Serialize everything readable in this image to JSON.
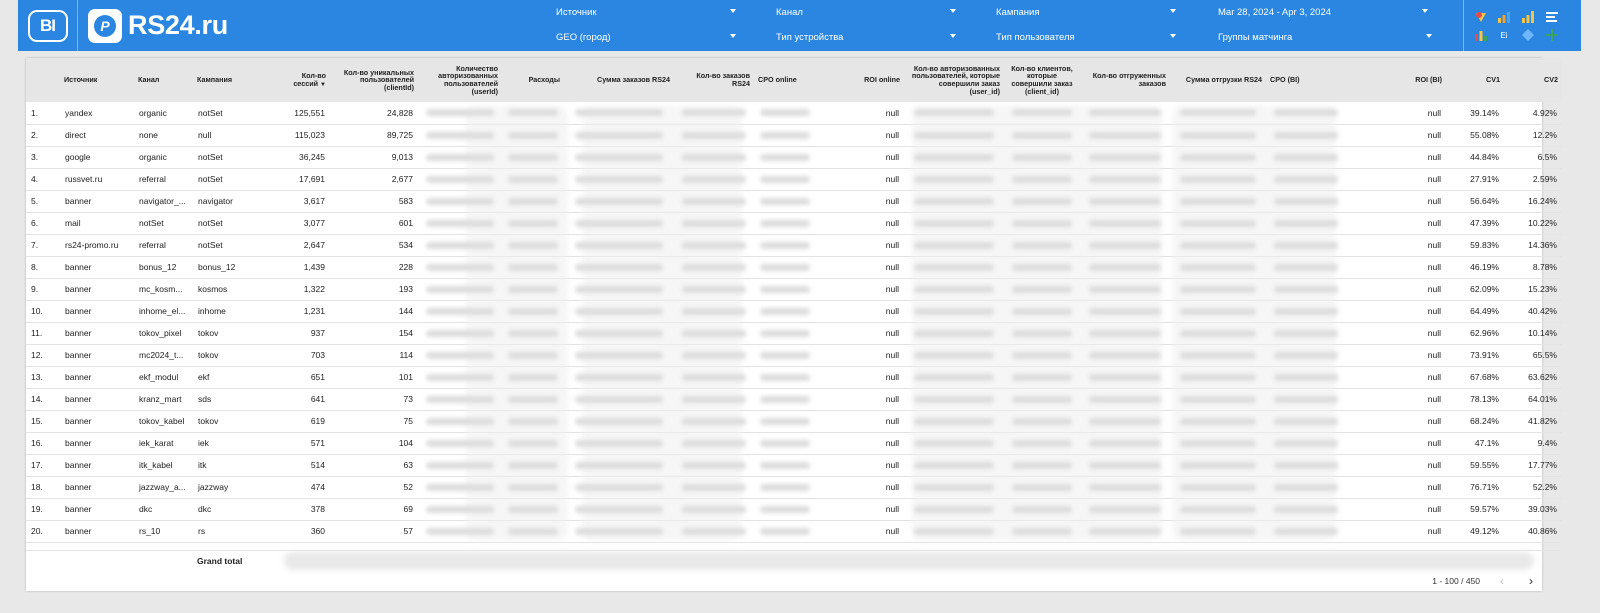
{
  "logos": {
    "bi": "BI",
    "brand_mark": "P",
    "brand": "RS24.ru"
  },
  "filters": [
    {
      "label": "Источник"
    },
    {
      "label": "Канал"
    },
    {
      "label": "Кампания"
    },
    {
      "label": "Mar 28, 2024 - Apr 3, 2024"
    },
    {
      "label": "GEO (город)"
    },
    {
      "label": "Тип устройства"
    },
    {
      "label": "Тип пользователя"
    },
    {
      "label": "Группы матчинга"
    }
  ],
  "toolbar_icons": [
    "bi-logo-color-icon",
    "bi-bar-chart-icon",
    "bar-chart-icon",
    "text-lines-icon",
    "bi-bar-red-icon",
    "bi-small-icon",
    "diamond-icon",
    "grid-plus-icon"
  ],
  "toolbar_labels": {
    "small1": "Ei",
    "small2": "Ei"
  },
  "table": {
    "columns": [
      "",
      "Источник",
      "Канал",
      "Кампания",
      "Кол-во сессий",
      "Кол-во уникальных пользователей (clientId)",
      "Количество авторизованных пользователей (userId)",
      "Расходы",
      "Сумма заказов RS24",
      "Кол-во заказов RS24",
      "CPO online",
      "ROI online",
      "Кол-во авторизованных пользователей, которые совершили заказ (user_id)",
      "Кол-во клиентов, которые совершили заказ (client_id)",
      "Кол-во отгруженных заказов",
      "Сумма отгрузки RS24",
      "CPO (BI)",
      "ROI (BI)",
      "CV1",
      "CV2"
    ],
    "rows": [
      [
        "1.",
        "yandex",
        "organic",
        "notSet",
        "125,551",
        "24,828",
        "null",
        "39.14%",
        "4.92%"
      ],
      [
        "2.",
        "direct",
        "none",
        "null",
        "115,023",
        "89,725",
        "null",
        "55.08%",
        "12.2%"
      ],
      [
        "3.",
        "google",
        "organic",
        "notSet",
        "36,245",
        "9,013",
        "null",
        "44.84%",
        "6.5%"
      ],
      [
        "4.",
        "russvet.ru",
        "referral",
        "notSet",
        "17,691",
        "2,677",
        "null",
        "27.91%",
        "2.59%"
      ],
      [
        "5.",
        "banner",
        "navigator_...",
        "navigator",
        "3,617",
        "583",
        "null",
        "56.64%",
        "16.24%"
      ],
      [
        "6.",
        "mail",
        "notSet",
        "notSet",
        "3,077",
        "601",
        "null",
        "47.39%",
        "10.22%"
      ],
      [
        "7.",
        "rs24-promo.ru",
        "referral",
        "notSet",
        "2,647",
        "534",
        "null",
        "59.83%",
        "14.36%"
      ],
      [
        "8.",
        "banner",
        "bonus_12",
        "bonus_12",
        "1,439",
        "228",
        "null",
        "46.19%",
        "8.78%"
      ],
      [
        "9.",
        "banner",
        "mc_kosm...",
        "kosmos",
        "1,322",
        "193",
        "null",
        "62.09%",
        "15.23%"
      ],
      [
        "10.",
        "banner",
        "inhome_el...",
        "inhome",
        "1,231",
        "144",
        "null",
        "64.49%",
        "40.42%"
      ],
      [
        "11.",
        "banner",
        "tokov_pixel",
        "tokov",
        "937",
        "154",
        "null",
        "62.96%",
        "10.14%"
      ],
      [
        "12.",
        "banner",
        "mc2024_t...",
        "tokov",
        "703",
        "114",
        "null",
        "73.91%",
        "65.5%"
      ],
      [
        "13.",
        "banner",
        "ekf_modul",
        "ekf",
        "651",
        "101",
        "null",
        "67.68%",
        "63.62%"
      ],
      [
        "14.",
        "banner",
        "kranz_mart",
        "sds",
        "641",
        "73",
        "null",
        "78.13%",
        "64.01%"
      ],
      [
        "15.",
        "banner",
        "tokov_kabel",
        "tokov",
        "619",
        "75",
        "null",
        "68.24%",
        "41.82%"
      ],
      [
        "16.",
        "banner",
        "iek_karat",
        "iek",
        "571",
        "104",
        "null",
        "47.1%",
        "9.4%"
      ],
      [
        "17.",
        "banner",
        "itk_kabel",
        "itk",
        "514",
        "63",
        "null",
        "59.55%",
        "17.77%"
      ],
      [
        "18.",
        "banner",
        "jazzway_a...",
        "jazzway",
        "474",
        "52",
        "null",
        "76.71%",
        "52.2%"
      ],
      [
        "19.",
        "banner",
        "dkc",
        "dkc",
        "378",
        "69",
        "null",
        "59.57%",
        "39.03%"
      ],
      [
        "20.",
        "banner",
        "rs_10",
        "rs",
        "360",
        "57",
        "null",
        "49.12%",
        "40.86%"
      ]
    ],
    "grand_total_label": "Grand total",
    "pager": "1 - 100 / 450"
  },
  "colors": {
    "header": "#2a86e0",
    "table_header": "#e6e6e6"
  }
}
